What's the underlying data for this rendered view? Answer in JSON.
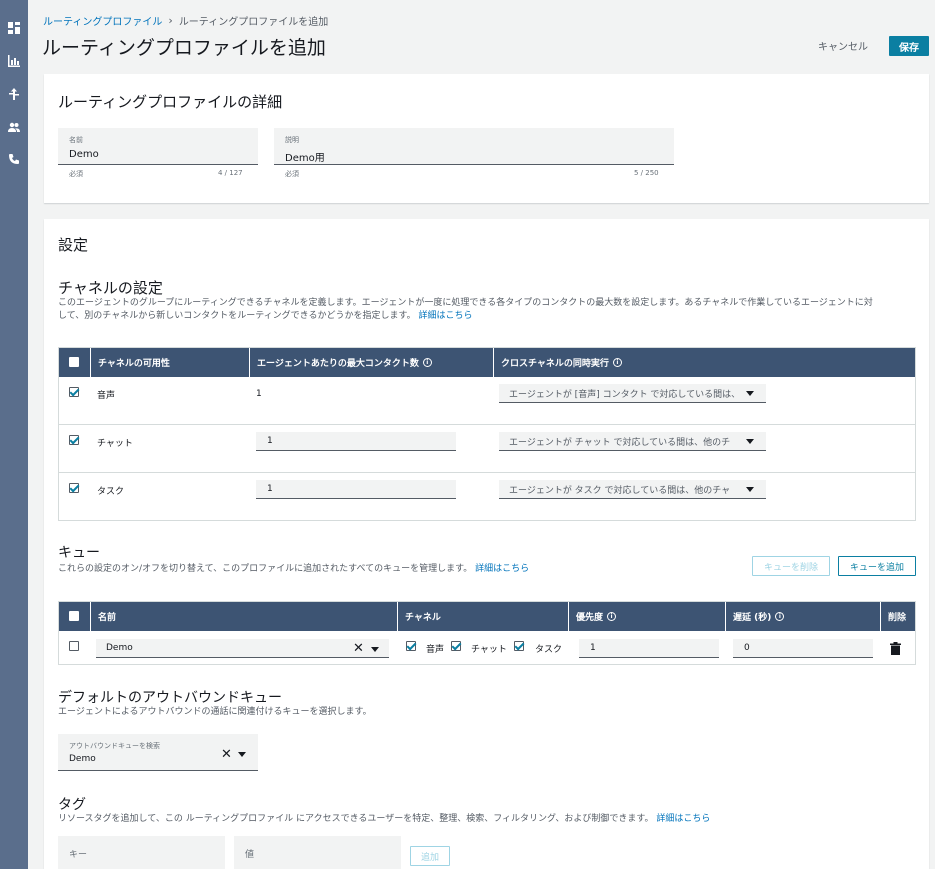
{
  "breadcrumb": {
    "parent": "ルーティングプロファイル",
    "separator": "›",
    "current": "ルーティングプロファイルを追加"
  },
  "page": {
    "title": "ルーティングプロファイルを追加",
    "cancel": "キャンセル",
    "save": "保存"
  },
  "details": {
    "heading": "ルーティングプロファイルの詳細",
    "name": {
      "label": "名前",
      "value": "Demo",
      "hint": "必須",
      "count": "4 / 127"
    },
    "description": {
      "label": "説明",
      "value": "Demo用",
      "hint": "必須",
      "count": "5 / 250"
    }
  },
  "settings": {
    "heading": "設定"
  },
  "channels": {
    "heading": "チャネルの設定",
    "desc1": "このエージェントのグループにルーティングできるチャネルを定義します。エージェントが一度に処理できる各タイプのコンタクトの最大数を設定します。あるチャネルで作業しているエージェントに対",
    "desc2": "して、別のチャネルから新しいコンタクトをルーティングできるかどうかを指定します。",
    "link": "詳細はこちら",
    "columns": [
      "チャネルの可用性",
      "エージェントあたりの最大コンタクト数",
      "クロスチャネルの同時実行"
    ],
    "rows": [
      {
        "name": "音声",
        "max": "1",
        "cross": "エージェントが [音声] コンタクト で対応している間は、"
      },
      {
        "name": "チャット",
        "max": "1",
        "cross": "エージェントが チャット で対応している間は、他のチ"
      },
      {
        "name": "タスク",
        "max": "1",
        "cross": "エージェントが タスク で対応している間は、他のチャ"
      }
    ]
  },
  "queues": {
    "heading": "キュー",
    "desc": "これらの設定のオン/オフを切り替えて、このプロファイルに追加されたすべてのキューを管理します。",
    "link": "詳細はこちら",
    "remove": "キューを削除",
    "add": "キューを追加",
    "columns": [
      "名前",
      "チャネル",
      "優先度",
      "遅延 (秒)",
      "削除"
    ],
    "row": {
      "name": "Demo",
      "ch1": "音声",
      "ch2": "チャット",
      "ch3": "タスク",
      "priority": "1",
      "delay": "0"
    }
  },
  "outbound": {
    "heading": "デフォルトのアウトバウンドキュー",
    "desc": "エージェントによるアウトバウンドの通話に関連付けるキューを選択します。",
    "label": "アウトバウンドキューを検索",
    "value": "Demo"
  },
  "tags": {
    "heading": "タグ",
    "desc": "リソースタグを追加して、この ルーティングプロファイル にアクセスできるユーザーを特定、整理、検索、フィルタリング、および制御できます。",
    "link": "詳細はこちら",
    "key_placeholder": "キー",
    "value_placeholder": "値",
    "add": "追加"
  }
}
